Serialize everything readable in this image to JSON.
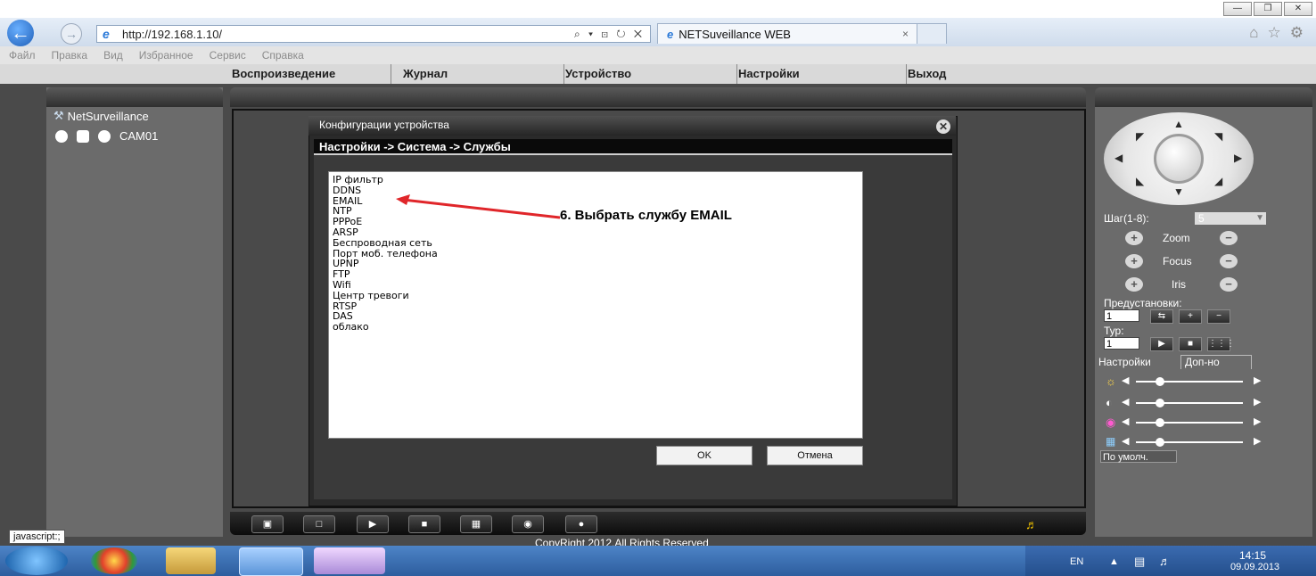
{
  "browser": {
    "url": "http://192.168.1.10/",
    "url_tools": "⌕ ▾ ⊡ ↻ ✕",
    "tab_title": "NETSuveillance WEB",
    "tab_close": "×",
    "window_controls": [
      "—",
      "❐",
      "✕"
    ],
    "right_icons": [
      "⌂",
      "☆",
      "⚙"
    ]
  },
  "menubar": [
    "Файл",
    "Правка",
    "Вид",
    "Избранное",
    "Сервис",
    "Справка"
  ],
  "app_nav": [
    "Воспроизведение",
    "Журнал",
    "Устройство",
    "Настройки",
    "Выход"
  ],
  "left": {
    "brand": "NetSurveillance",
    "camera": "CAM01"
  },
  "dialog": {
    "title": "Конфигурации устройства",
    "breadcrumb": "Настройки -> Система -> Службы",
    "items": [
      "IP фильтр",
      "DDNS",
      "EMAIL",
      "NTP",
      "PPPoE",
      "ARSP",
      "Беспроводная сеть",
      "Порт моб. телефона",
      "UPNP",
      "FTP",
      "Wifi",
      "Центр тревоги",
      "RTSP",
      "DAS",
      "облако"
    ],
    "annotation": "6. Выбрать службу EMAIL",
    "ok": "OK",
    "cancel": "Отмена"
  },
  "ptz": {
    "step_label": "Шаг(1-8):",
    "step_value": "5",
    "zoom": "Zoom",
    "focus": "Focus",
    "iris": "Iris",
    "presets_label": "Предустановки:",
    "preset_value": "1",
    "tour_label": "Тур:",
    "tour_value": "1",
    "tab_settings": "Настройки",
    "tab_extra": "Доп-но",
    "default_btn": "По умолч."
  },
  "status": {
    "tooltip": "javascript:;",
    "copyright": "CopyRight 2012,All Rights Reserved"
  },
  "taskbar": {
    "lang": "EN",
    "time": "14:15",
    "date": "09.09.2013"
  },
  "colors": {
    "accent_red": "#e0262a",
    "panel_gray": "#6b6b6b",
    "taskbar_blue": "#2d5d9e"
  }
}
